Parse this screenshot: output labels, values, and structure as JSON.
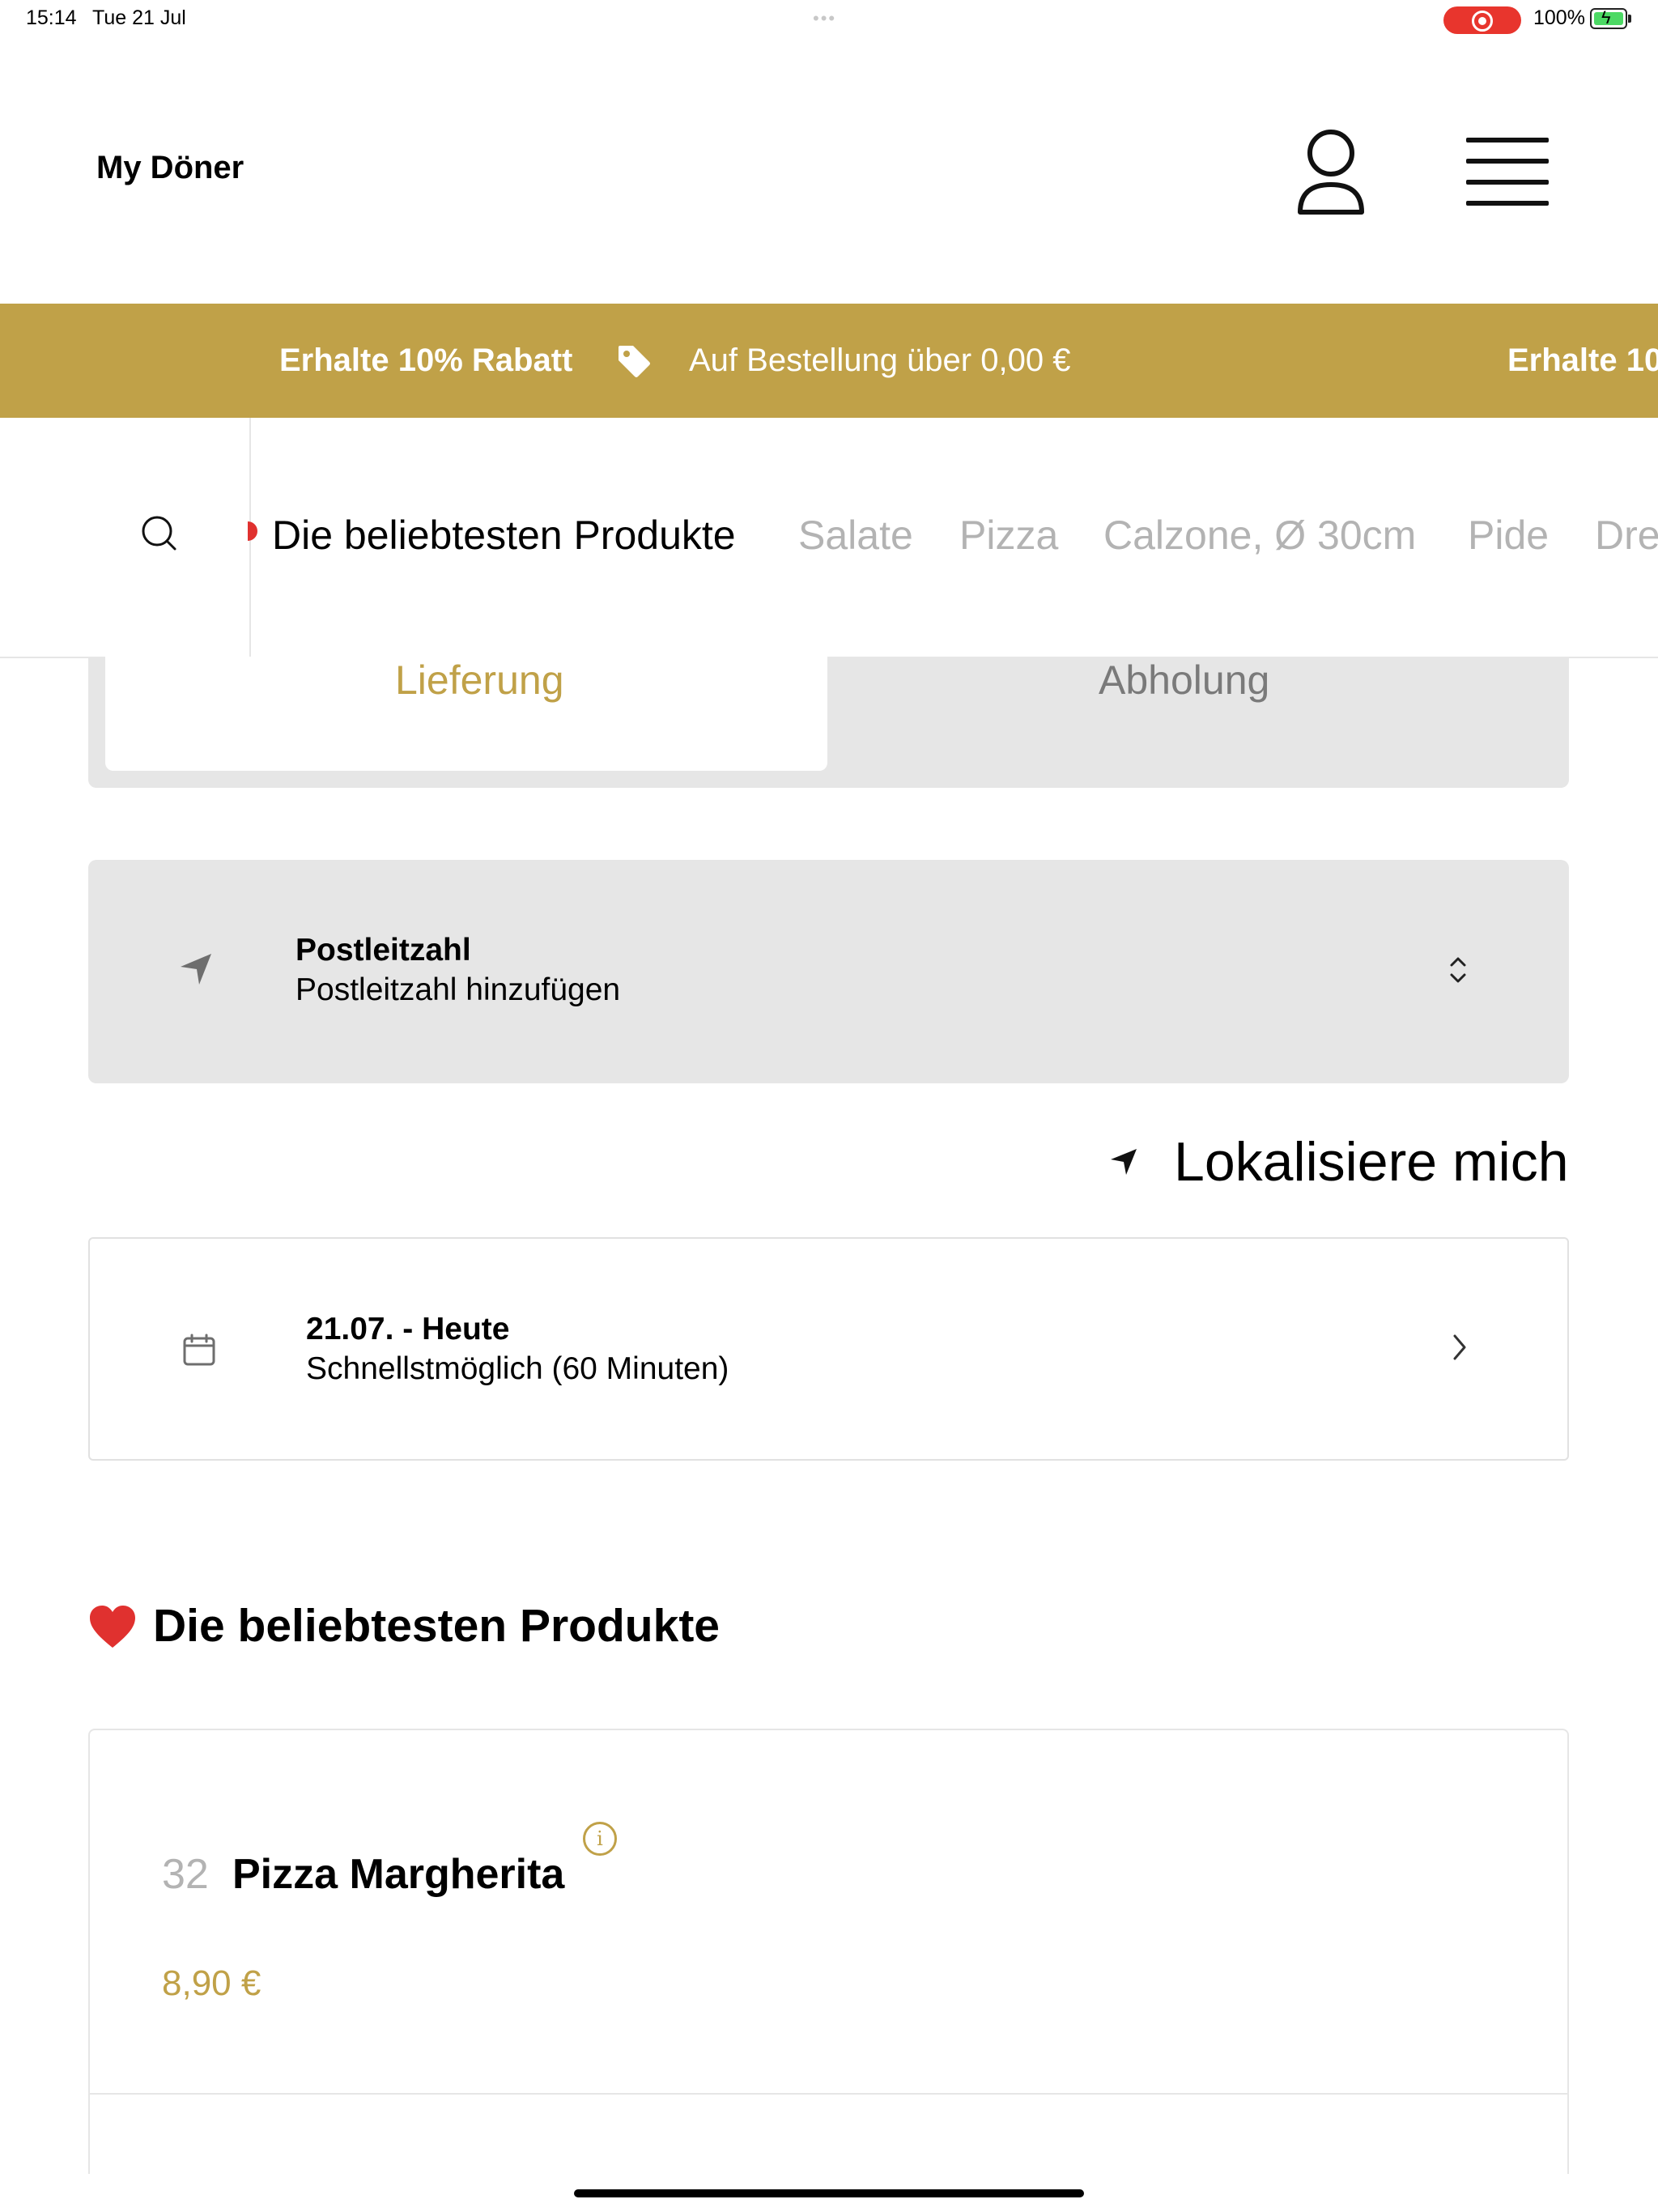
{
  "status_bar": {
    "time": "15:14",
    "date": "Tue 21 Jul",
    "dots": "•••",
    "battery_pct": "100%",
    "record_color": "#e8352d",
    "battery_color": "#4cd964"
  },
  "header": {
    "logo": "My Döner",
    "account_icon": "user-icon",
    "menu_icon": "hamburger-icon"
  },
  "promo": {
    "title": "Erhalte 10% Rabatt",
    "subtitle": "Auf Bestellung über 0,00 €",
    "title_repeat": "Erhalte 10",
    "icon": "tag-icon",
    "background": "#c0a148"
  },
  "categories": {
    "search_icon": "search-icon",
    "items": [
      {
        "label": "Die beliebtesten Produkte",
        "active": true
      },
      {
        "label": "Salate",
        "active": false
      },
      {
        "label": "Pizza",
        "active": false
      },
      {
        "label": "Calzone, Ø 30cm",
        "active": false
      },
      {
        "label": "Pide",
        "active": false
      },
      {
        "label": "Dre",
        "active": false
      }
    ]
  },
  "order_mode": {
    "delivery": "Lieferung",
    "pickup": "Abholung",
    "selected": "Lieferung"
  },
  "postcode": {
    "title": "Postleitzahl",
    "placeholder": "Postleitzahl hinzufügen",
    "icon": "location-arrow-icon"
  },
  "locate": {
    "label": "Lokalisiere mich",
    "icon": "location-arrow-icon"
  },
  "schedule": {
    "title": "21.07. - Heute",
    "subtitle": "Schnellstmöglich (60 Minuten)",
    "icon": "calendar-icon"
  },
  "section": {
    "title": "Die beliebtesten Produkte",
    "icon": "heart-icon"
  },
  "products": [
    {
      "number": "32",
      "name": "Pizza Margherita",
      "price": "8,90 €",
      "info_icon": "info-icon"
    }
  ],
  "accent_color": "#c0a148"
}
